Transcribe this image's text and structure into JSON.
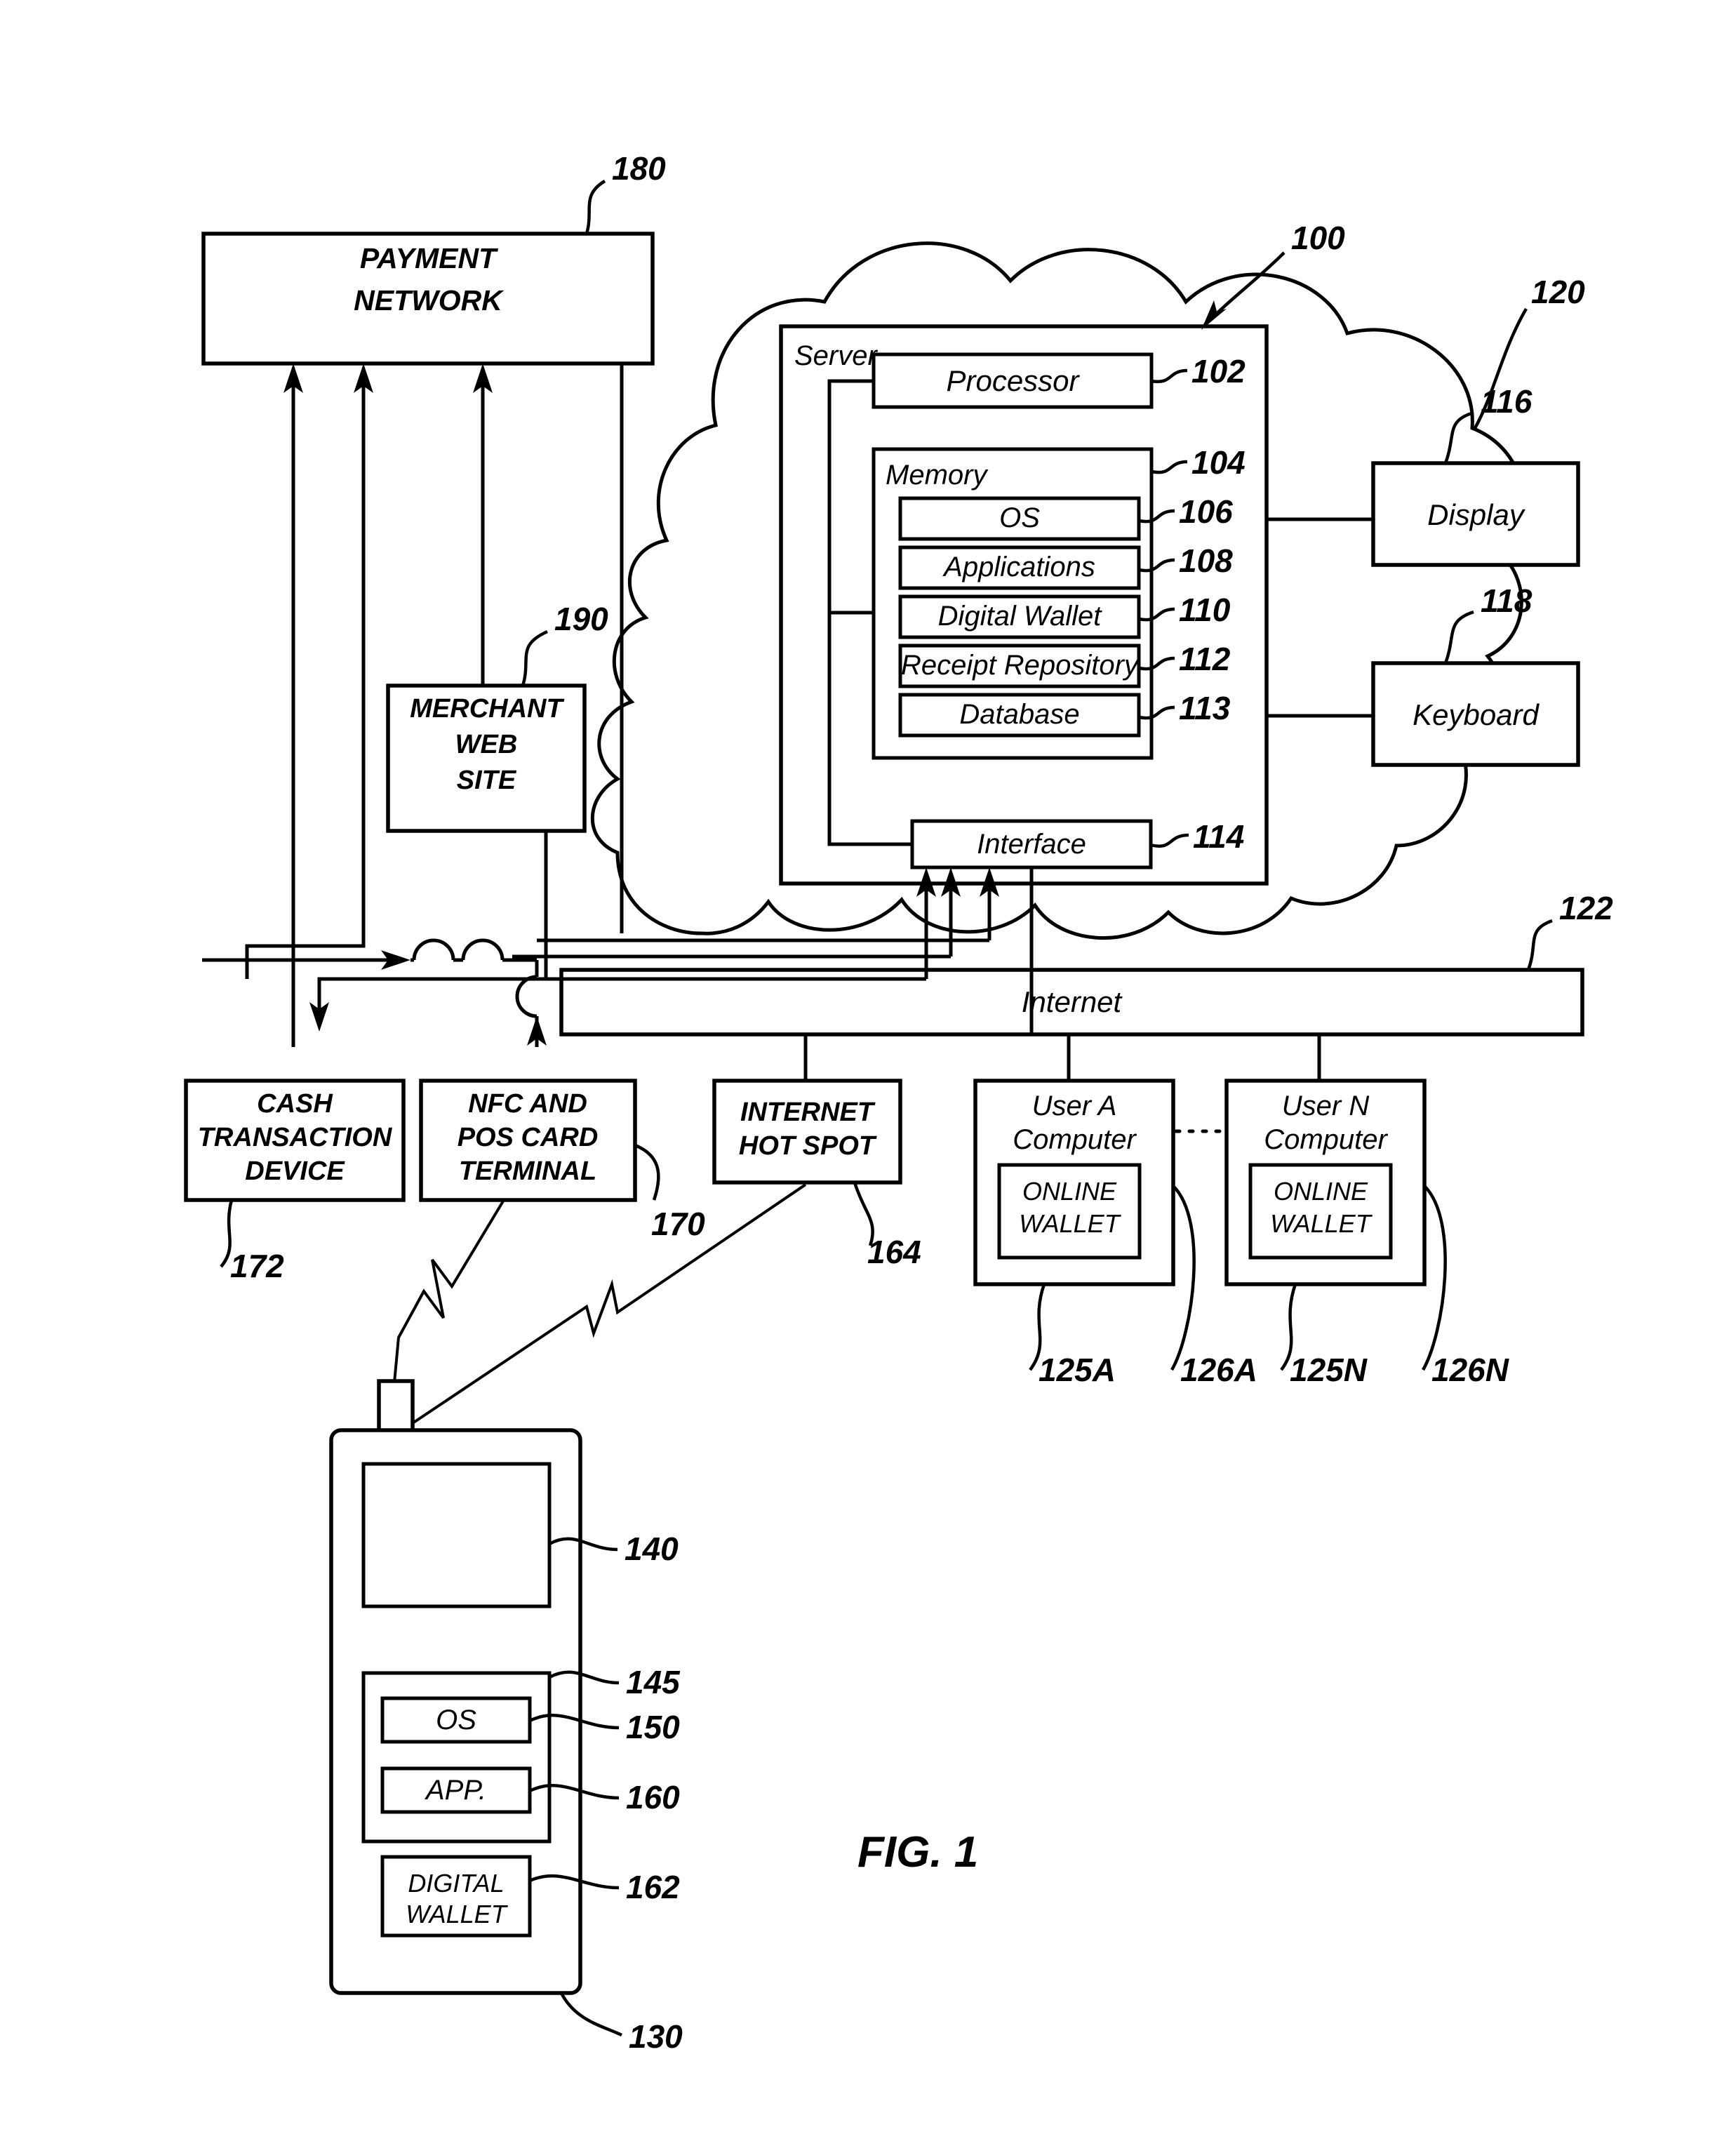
{
  "figure": {
    "caption": "FIG. 1"
  },
  "payment_network": {
    "line1": "PAYMENT",
    "line2": "NETWORK",
    "ref": "180"
  },
  "merchant": {
    "line1": "MERCHANT",
    "line2": "WEB",
    "line3": "SITE",
    "ref": "190"
  },
  "cloud": {
    "ref": "120"
  },
  "server": {
    "title": "Server",
    "ref": "100",
    "processor": {
      "label": "Processor",
      "ref": "102"
    },
    "memory": {
      "label": "Memory",
      "ref": "104"
    },
    "os": {
      "label": "OS",
      "ref": "106"
    },
    "applications": {
      "label": "Applications",
      "ref": "108"
    },
    "digital_wallet": {
      "label": "Digital Wallet",
      "ref": "110"
    },
    "receipt_repository": {
      "label": "Receipt Repository",
      "ref": "112"
    },
    "database": {
      "label": "Database",
      "ref": "113"
    },
    "interface": {
      "label": "Interface",
      "ref": "114"
    }
  },
  "peripherals": {
    "display": {
      "label": "Display",
      "ref": "116"
    },
    "keyboard": {
      "label": "Keyboard",
      "ref": "118"
    }
  },
  "internet": {
    "label": "Internet",
    "ref": "122"
  },
  "devices": {
    "cash": {
      "line1": "CASH",
      "line2": "TRANSACTION",
      "line3": "DEVICE",
      "ref": "172"
    },
    "nfc": {
      "line1": "NFC AND",
      "line2": "POS CARD",
      "line3": "TERMINAL",
      "ref": "170"
    },
    "hotspot": {
      "line1": "INTERNET",
      "line2": "HOT SPOT",
      "ref": "164"
    }
  },
  "user_computers": [
    {
      "line1": "User A",
      "line2": "Computer",
      "ref": "125A",
      "wallet_line1": "ONLINE",
      "wallet_line2": "WALLET",
      "wallet_ref": "126A"
    },
    {
      "line1": "User N",
      "line2": "Computer",
      "ref": "125N",
      "wallet_line1": "ONLINE",
      "wallet_line2": "WALLET",
      "wallet_ref": "126N"
    }
  ],
  "mobile": {
    "ref": "130",
    "screen_ref": "140",
    "memory_ref": "145",
    "os": {
      "label": "OS",
      "ref": "150"
    },
    "app": {
      "label": "APP.",
      "ref": "160"
    },
    "wallet": {
      "line1": "DIGITAL",
      "line2": "WALLET",
      "ref": "162"
    }
  },
  "colors": {
    "ink": "#000000",
    "paper": "#ffffff"
  }
}
